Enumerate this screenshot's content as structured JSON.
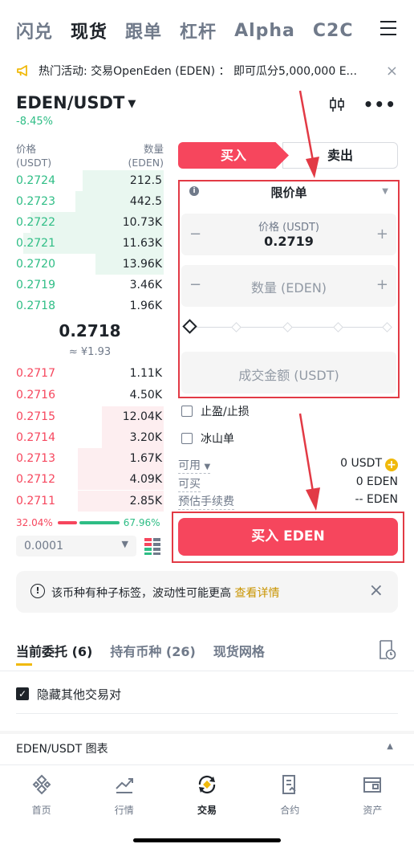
{
  "top_tabs": [
    "闪兑",
    "现货",
    "跟单",
    "杠杆",
    "Alpha",
    "C2C"
  ],
  "announcement": {
    "text": "热门活动: 交易OpenEden (EDEN) ： 即可瓜分5,000,000 E...",
    "close": "×"
  },
  "pair": {
    "symbol": "EDEN/USDT",
    "change": "-8.45%"
  },
  "orderbook": {
    "price_header": "价格",
    "price_unit": "(USDT)",
    "qty_header": "数量",
    "qty_unit": "(EDEN)",
    "asks": [
      {
        "price": "0.2724",
        "qty": "212.5",
        "depth": 0.55
      },
      {
        "price": "0.2723",
        "qty": "442.5",
        "depth": 0.6
      },
      {
        "price": "0.2722",
        "qty": "10.73K",
        "depth": 0.9
      },
      {
        "price": "0.2721",
        "qty": "11.63K",
        "depth": 0.95
      },
      {
        "price": "0.2720",
        "qty": "13.96K",
        "depth": 0.46
      },
      {
        "price": "0.2719",
        "qty": "3.46K",
        "depth": 0
      },
      {
        "price": "0.2718",
        "qty": "1.96K",
        "depth": 0
      }
    ],
    "mid_price": "0.2718",
    "mid_fiat": "≈ ¥1.93",
    "bids": [
      {
        "price": "0.2717",
        "qty": "1.11K",
        "depth": 0
      },
      {
        "price": "0.2716",
        "qty": "4.50K",
        "depth": 0
      },
      {
        "price": "0.2715",
        "qty": "12.04K",
        "depth": 0.42
      },
      {
        "price": "0.2714",
        "qty": "3.20K",
        "depth": 0.42
      },
      {
        "price": "0.2713",
        "qty": "1.67K",
        "depth": 0.58
      },
      {
        "price": "0.2712",
        "qty": "4.09K",
        "depth": 0.58
      },
      {
        "price": "0.2711",
        "qty": "2.85K",
        "depth": 0.58
      }
    ],
    "sell_ratio": "32.04%",
    "buy_ratio": "67.96%",
    "precision": "0.0001"
  },
  "order_form": {
    "buy_label": "买入",
    "sell_label": "卖出",
    "order_type": "限价单",
    "price_label": "价格 (USDT)",
    "price_value": "0.2719",
    "qty_placeholder": "数量 (EDEN)",
    "total_placeholder": "成交金额 (USDT)",
    "minus": "−",
    "plus": "+",
    "tp_sl": "止盈/止损",
    "iceberg": "冰山单",
    "available_label": "可用",
    "available_value": "0 USDT",
    "can_buy_label": "可买",
    "can_buy_value": "0 EDEN",
    "fee_label": "预估手续费",
    "fee_value": "-- EDEN",
    "submit": "买入 EDEN"
  },
  "notice": {
    "text": "该币种有种子标签，波动性可能更高",
    "link": "查看详情"
  },
  "orders_tabs": [
    "当前委托 (6)",
    "持有币种 (26)",
    "现货网格"
  ],
  "hide_other_pairs": "隐藏其他交易对",
  "chart_link": "EDEN/USDT 图表",
  "bottom_nav": [
    "首页",
    "行情",
    "交易",
    "合约",
    "资产"
  ],
  "colors": {
    "buy": "#f6465d",
    "up": "#2ebd85",
    "brand": "#f0b90b",
    "highlight": "#e23a45"
  }
}
